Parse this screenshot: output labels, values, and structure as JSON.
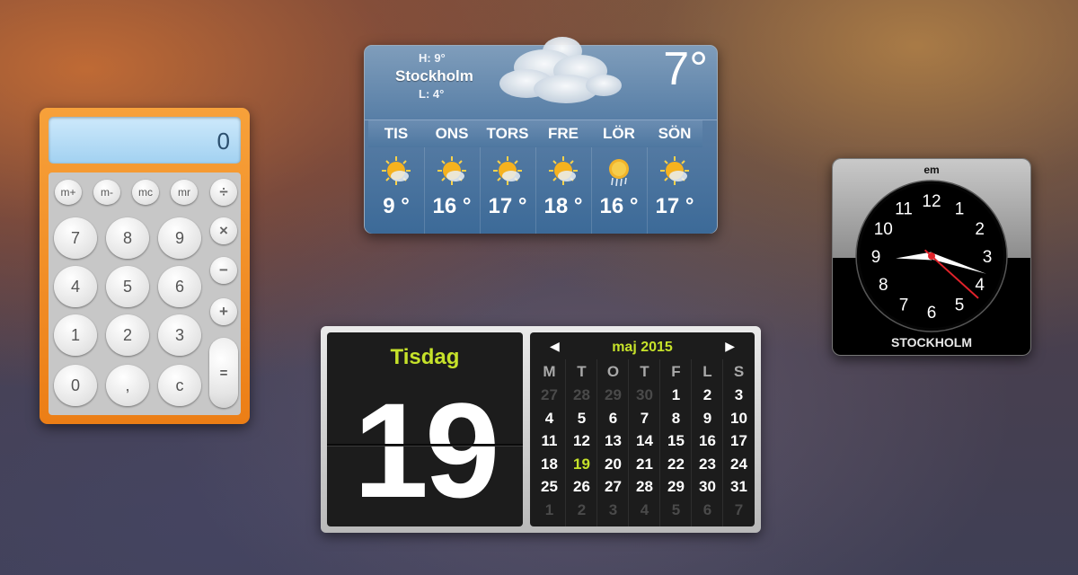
{
  "calculator": {
    "display": "0",
    "memory_keys": [
      "m+",
      "m-",
      "mc",
      "mr"
    ],
    "rows": [
      [
        "7",
        "8",
        "9"
      ],
      [
        "4",
        "5",
        "6"
      ],
      [
        "1",
        "2",
        "3"
      ],
      [
        "0",
        ",",
        "c"
      ]
    ],
    "operators": [
      "÷",
      "×",
      "−",
      "+"
    ],
    "equals": "="
  },
  "weather": {
    "high": "H: 9°",
    "city": "Stockholm",
    "low": "L: 4°",
    "current_temp": "7°",
    "forecast": [
      {
        "day": "TIS",
        "temp": "9 °",
        "icon": "sun-cloud-icon"
      },
      {
        "day": "ONS",
        "temp": "16 °",
        "icon": "sun-cloud-icon"
      },
      {
        "day": "TORS",
        "temp": "17 °",
        "icon": "sun-cloud-icon"
      },
      {
        "day": "FRE",
        "temp": "18 °",
        "icon": "sun-cloud-icon"
      },
      {
        "day": "LÖR",
        "temp": "16 °",
        "icon": "sun-rain-icon"
      },
      {
        "day": "SÖN",
        "temp": "17 °",
        "icon": "sun-cloud-icon"
      }
    ]
  },
  "clock": {
    "ampm": "em",
    "city": "STOCKHOLM",
    "numbers": [
      "12",
      "1",
      "2",
      "3",
      "4",
      "5",
      "6",
      "7",
      "8",
      "9",
      "10",
      "11"
    ],
    "time": {
      "hour": 3,
      "minute": 13,
      "second": 17
    }
  },
  "calendar": {
    "day_name": "Tisdag",
    "day_number": "19",
    "month_label": "maj 2015",
    "prev_arrow": "◀",
    "next_arrow": "▶",
    "weekdays": [
      "M",
      "T",
      "O",
      "T",
      "F",
      "L",
      "S"
    ],
    "weeks": [
      [
        "27",
        "28",
        "29",
        "30",
        "1",
        "2",
        "3"
      ],
      [
        "4",
        "5",
        "6",
        "7",
        "8",
        "9",
        "10"
      ],
      [
        "11",
        "12",
        "13",
        "14",
        "15",
        "16",
        "17"
      ],
      [
        "18",
        "19",
        "20",
        "21",
        "22",
        "23",
        "24"
      ],
      [
        "25",
        "26",
        "27",
        "28",
        "29",
        "30",
        "31"
      ],
      [
        "1",
        "2",
        "3",
        "4",
        "5",
        "6",
        "7"
      ]
    ],
    "dim_cells": [
      [
        0,
        0
      ],
      [
        0,
        1
      ],
      [
        0,
        2
      ],
      [
        0,
        3
      ],
      [
        5,
        0
      ],
      [
        5,
        1
      ],
      [
        5,
        2
      ],
      [
        5,
        3
      ],
      [
        5,
        4
      ],
      [
        5,
        5
      ],
      [
        5,
        6
      ]
    ],
    "today_cell": [
      3,
      1
    ]
  }
}
